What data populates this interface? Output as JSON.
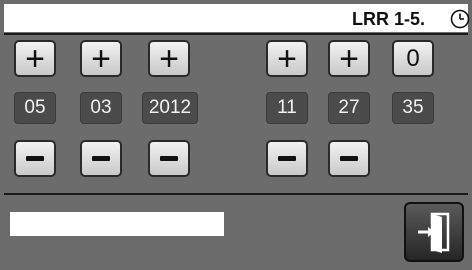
{
  "header": {
    "title": "LRR 1-5."
  },
  "date": {
    "month": "05",
    "day": "03",
    "year": "2012"
  },
  "time": {
    "hour": "11",
    "minute": "27",
    "second_button_label": "0",
    "second": "35"
  },
  "buttons": {
    "plus_label": "+"
  },
  "icons": {
    "clock": "clock-icon",
    "exit": "exit-door-icon"
  },
  "colors": {
    "background": "#6c6c6c",
    "value_box": "#4b4b4b",
    "button": "#dcdcdc"
  }
}
